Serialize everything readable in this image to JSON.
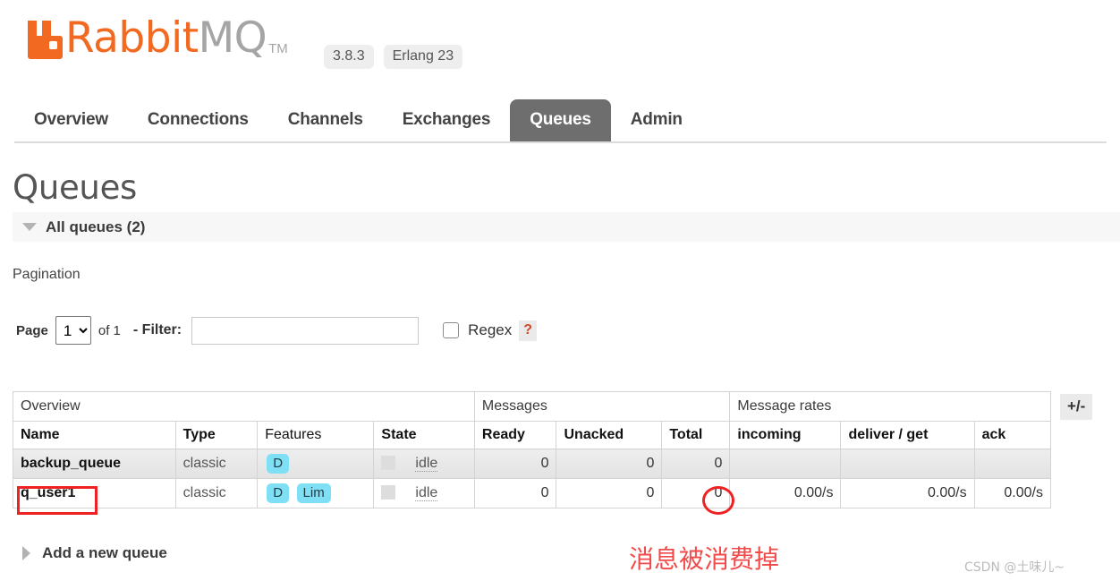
{
  "brand": {
    "name_part1": "Rabbit",
    "name_part2": "MQ",
    "trademark": "TM",
    "logo_icon": "rabbit-logo-icon",
    "version": "3.8.3",
    "erlang": "Erlang 23",
    "accent_color": "#f26921"
  },
  "nav": {
    "items": [
      {
        "label": "Overview",
        "active": false
      },
      {
        "label": "Connections",
        "active": false
      },
      {
        "label": "Channels",
        "active": false
      },
      {
        "label": "Exchanges",
        "active": false
      },
      {
        "label": "Queues",
        "active": true
      },
      {
        "label": "Admin",
        "active": false
      }
    ],
    "active_bg": "#6e6e6e"
  },
  "page": {
    "title": "Queues",
    "section_label": "All queues (2)",
    "section_toggle_icon": "triangle-down-icon"
  },
  "pagination": {
    "heading": "Pagination",
    "page_label": "Page",
    "page_value": "1",
    "page_options": [
      "1"
    ],
    "of_label": "of 1",
    "filter_label": "- Filter:",
    "filter_value": "",
    "filter_placeholder": "",
    "regex_label": "Regex",
    "regex_checked": false,
    "help_label": "?"
  },
  "table": {
    "group_headers": [
      {
        "label": "Overview",
        "span": 4
      },
      {
        "label": "Messages",
        "span": 3
      },
      {
        "label": "Message rates",
        "span": 3
      }
    ],
    "columns": [
      {
        "label": "Name",
        "sortable": true
      },
      {
        "label": "Type",
        "sortable": true
      },
      {
        "label": "Features",
        "sortable": false
      },
      {
        "label": "State",
        "sortable": true
      },
      {
        "label": "Ready",
        "sortable": true
      },
      {
        "label": "Unacked",
        "sortable": true
      },
      {
        "label": "Total",
        "sortable": true
      },
      {
        "label": "incoming",
        "sortable": true
      },
      {
        "label": "deliver / get",
        "sortable": true
      },
      {
        "label": "ack",
        "sortable": true
      }
    ],
    "toggle_columns_label": "+/-",
    "rows": [
      {
        "name": "backup_queue",
        "type": "classic",
        "features": [
          "D"
        ],
        "state": "idle",
        "ready": "0",
        "unacked": "0",
        "total": "0",
        "incoming": "",
        "deliver_get": "",
        "ack": ""
      },
      {
        "name": "q_user1",
        "type": "classic",
        "features": [
          "D",
          "Lim"
        ],
        "state": "idle",
        "ready": "0",
        "unacked": "0",
        "total": "0",
        "incoming": "0.00/s",
        "deliver_get": "0.00/s",
        "ack": "0.00/s"
      }
    ],
    "badge_color": "#7fdff5",
    "state_swatch_color": "#dddddd"
  },
  "add_queue": {
    "label": "Add a new queue",
    "toggle_icon": "triangle-right-icon"
  },
  "annotations": {
    "note_text": "消息被消费掉",
    "note_color": "#f14a4a",
    "highlight_color": "#ee2222",
    "watermark": "CSDN @土味儿~"
  }
}
